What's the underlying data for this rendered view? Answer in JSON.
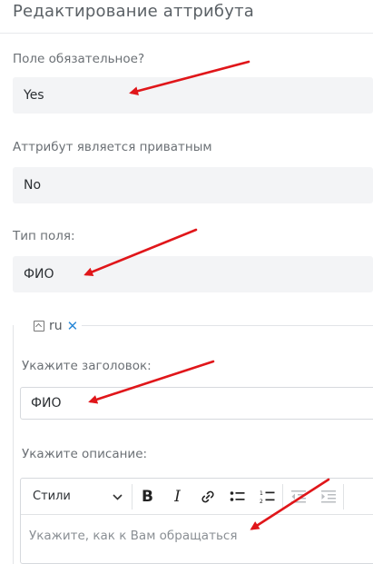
{
  "page": {
    "title": "Редактирование аттрибута"
  },
  "fields": {
    "required": {
      "label": "Поле обязательное?",
      "value": "Yes"
    },
    "private": {
      "label": "Аттрибут является приватным",
      "value": "No"
    },
    "type": {
      "label": "Тип поля:",
      "value": "ФИО"
    }
  },
  "language_panel": {
    "lang": "ru",
    "icons": {
      "collapse": "collapse-square-icon",
      "remove": "close-x-icon"
    },
    "title_label": "Укажите заголовок:",
    "title_value": "ФИО",
    "description_label": "Укажите описание:",
    "editor": {
      "styles_label": "Стили",
      "toolbar_icons": [
        "bold-icon",
        "italic-icon",
        "link-icon",
        "bulleted-list-icon",
        "numbered-list-icon",
        "outdent-icon",
        "indent-icon"
      ],
      "placeholder": "Укажите, как к Вам обращаться"
    }
  },
  "annotation_color": "#e0161a"
}
